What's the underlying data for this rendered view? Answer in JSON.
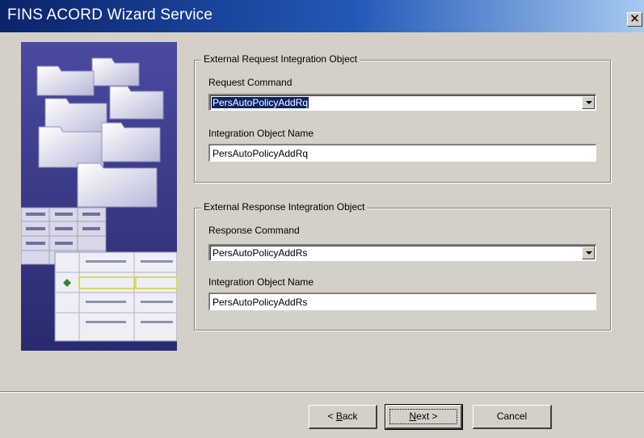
{
  "window": {
    "title": "FINS ACORD Wizard Service",
    "close_symbol": "✕"
  },
  "request_group": {
    "legend": "External Request Integration Object",
    "command_label": "Request Command",
    "command_value": "PersAutoPolicyAddRq",
    "object_name_label": "Integration Object Name",
    "object_name_value": "PersAutoPolicyAddRq"
  },
  "response_group": {
    "legend": "External Response Integration Object",
    "command_label": "Response Command",
    "command_value": "PersAutoPolicyAddRs",
    "object_name_label": "Integration Object Name",
    "object_name_value": "PersAutoPolicyAddRs"
  },
  "buttons": {
    "back_prefix": "< ",
    "back_hotkey": "B",
    "back_rest": "ack",
    "next_hotkey": "N",
    "next_rest": "ext >",
    "cancel": "Cancel"
  },
  "colors": {
    "title_bar_start": "#0a246a",
    "title_bar_end": "#a6caf0",
    "dialog_face": "#d4d0c8",
    "art_background": "#3a3a8c",
    "selection": "#0a246a"
  },
  "icons": [
    "close-icon",
    "dropdown-arrow-icon",
    "wizard-folders-illustration"
  ]
}
